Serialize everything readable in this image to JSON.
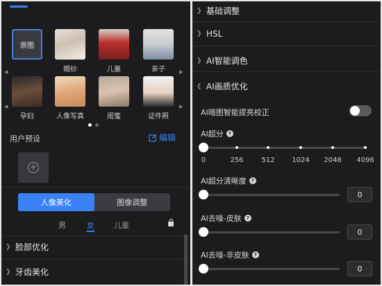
{
  "colors": {
    "accent": "#3a82f7",
    "panel_bg": "#1c1c1e",
    "control_bg": "#3c3c40"
  },
  "left_panel": {
    "presets_row1": [
      {
        "label": "",
        "tile_text": "原图",
        "icon": "original-tile"
      },
      {
        "label": "婚纱",
        "icon": "wedding-photo"
      },
      {
        "label": "儿童",
        "icon": "children-photo"
      },
      {
        "label": "亲子",
        "icon": "family-photo"
      }
    ],
    "presets_row2": [
      {
        "label": "孕妇",
        "icon": "maternity-photo"
      },
      {
        "label": "人像写真",
        "icon": "portrait-photo"
      },
      {
        "label": "闺蜜",
        "icon": "girlfriends-photo"
      },
      {
        "label": "证件照",
        "icon": "id-photo"
      }
    ],
    "page_dots": {
      "count": 2,
      "active": 1
    },
    "user_presets_title": "用户预设",
    "edit_label": "编辑",
    "mode_tabs": {
      "portrait": "人像美化",
      "image": "图像调整",
      "active": "portrait"
    },
    "gender_tabs": {
      "male": "男",
      "female": "女",
      "child": "儿童",
      "active": "female"
    },
    "sections": {
      "face": "脸部优化",
      "teeth": "牙齿美化"
    }
  },
  "right_panel": {
    "sections": {
      "basic": "基础调整",
      "hsl": "HSL",
      "ai_color": "AI智能调色",
      "ai_quality": "AI画质优化"
    },
    "dark_correction": {
      "label": "AI暗图智能提亮校正",
      "enabled": false
    },
    "super_res": {
      "label": "AI超分",
      "ticks": [
        "0",
        "256",
        "512",
        "1024",
        "2048",
        "4096"
      ],
      "value": "0"
    },
    "super_res_clarity": {
      "label": "AI超分清晰度",
      "value": "0"
    },
    "denoise_skin": {
      "label": "AI去噪-皮肤",
      "value": "0"
    },
    "denoise_nonskin": {
      "label": "AI去噪-非皮肤",
      "value": "0"
    }
  }
}
